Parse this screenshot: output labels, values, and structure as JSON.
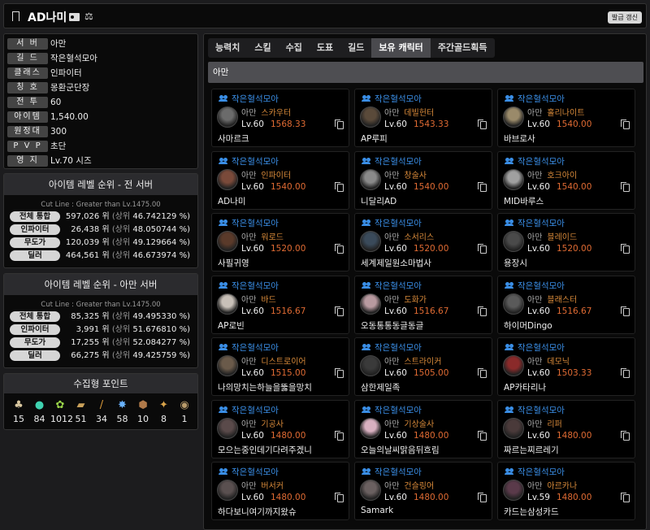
{
  "header": {
    "title": "AD나미",
    "refresh_label": "발급 갱신"
  },
  "info": [
    {
      "label": "서 버",
      "value": "아만"
    },
    {
      "label": "길 드",
      "value": "작은혈석모아"
    },
    {
      "label": "클래스",
      "value": "인파이터"
    },
    {
      "label": "칭 호",
      "value": "몽환군단장"
    },
    {
      "label": "전 투",
      "value": "60"
    },
    {
      "label": "아이템",
      "value": "1,540.00"
    },
    {
      "label": "원정대",
      "value": "300"
    },
    {
      "label": "P V P",
      "value": "초단"
    },
    {
      "label": "영 지",
      "value": "Lv.70 시즈"
    }
  ],
  "rank_all": {
    "title": "아이템 레벨 순위 - 전 서버",
    "cut": "Cut Line : Greater than Lv.1475.00",
    "rows": [
      {
        "label": "전체 통합",
        "rank": "597,026 위",
        "pct_label": "(상위",
        "pct": "46.742129 %)"
      },
      {
        "label": "인파이터",
        "rank": "26,438 위",
        "pct_label": "(상위",
        "pct": "48.050744 %)"
      },
      {
        "label": "무도가",
        "rank": "120,039 위",
        "pct_label": "(상위",
        "pct": "49.129664 %)"
      },
      {
        "label": "딜러",
        "rank": "464,561 위",
        "pct_label": "(상위",
        "pct": "46.673974 %)"
      }
    ]
  },
  "rank_server": {
    "title": "아이템 레벨 순위 - 아만 서버",
    "cut": "Cut Line : Greater than Lv.1475.00",
    "rows": [
      {
        "label": "전체 통합",
        "rank": "85,325 위",
        "pct_label": "(상위",
        "pct": "49.495330 %)"
      },
      {
        "label": "인파이터",
        "rank": "3,991 위",
        "pct_label": "(상위",
        "pct": "51.676810 %)"
      },
      {
        "label": "무도가",
        "rank": "17,255 위",
        "pct_label": "(상위",
        "pct": "52.084277 %)"
      },
      {
        "label": "딜러",
        "rank": "66,275 위",
        "pct_label": "(상위",
        "pct": "49.425759 %)"
      }
    ]
  },
  "collect": {
    "title": "수집형 포인트",
    "items": [
      {
        "icon": "mokoko-seed-icon",
        "glyph": "♣",
        "color": "#d9c7a0",
        "value": "15"
      },
      {
        "icon": "island-heart-icon",
        "glyph": "●",
        "color": "#3fd2b0",
        "value": "84"
      },
      {
        "icon": "giant-heart-icon",
        "glyph": "✿",
        "color": "#9bd64a",
        "value": "1012"
      },
      {
        "icon": "masterpiece-icon",
        "glyph": "▰",
        "color": "#c9a15a",
        "value": "51"
      },
      {
        "icon": "adventure-book-icon",
        "glyph": "/",
        "color": "#d99a3a",
        "value": "34"
      },
      {
        "icon": "sea-bounty-icon",
        "glyph": "✸",
        "color": "#6ab3ff",
        "value": "58"
      },
      {
        "icon": "ignea-token-icon",
        "glyph": "⬢",
        "color": "#b07a4a",
        "value": "10"
      },
      {
        "icon": "orpheus-star-icon",
        "glyph": "✦",
        "color": "#d8a34a",
        "value": "8"
      },
      {
        "icon": "world-tree-leaf-icon",
        "glyph": "◉",
        "color": "#b89a6a",
        "value": "1"
      }
    ]
  },
  "tabs": [
    {
      "label": "능력치",
      "active": false
    },
    {
      "label": "스킬",
      "active": false
    },
    {
      "label": "수집",
      "active": false
    },
    {
      "label": "도표",
      "active": false
    },
    {
      "label": "길드",
      "active": false
    },
    {
      "label": "보유 캐릭터",
      "active": true
    },
    {
      "label": "주간골드획득",
      "active": false
    }
  ],
  "server_bar": "아만",
  "characters": [
    {
      "guild": "작은혈석모아",
      "server": "아만",
      "class": "스카우터",
      "level": "Lv.60",
      "ilvl": "1568.33",
      "name": "사마르크",
      "avatar_color": "#6b6b6b"
    },
    {
      "guild": "작은혈석모아",
      "server": "아만",
      "class": "데빌헌터",
      "level": "Lv.60",
      "ilvl": "1543.33",
      "name": "AP루피",
      "avatar_color": "#5a4a3a"
    },
    {
      "guild": "작은혈석모아",
      "server": "아만",
      "class": "홀리나이트",
      "level": "Lv.60",
      "ilvl": "1540.00",
      "name": "바브로사",
      "avatar_color": "#9a8a6a"
    },
    {
      "guild": "작은혈석모아",
      "server": "아만",
      "class": "인파이터",
      "level": "Lv.60",
      "ilvl": "1540.00",
      "name": "AD나미",
      "avatar_color": "#7a4a3a"
    },
    {
      "guild": "작은혈석모아",
      "server": "아만",
      "class": "창술사",
      "level": "Lv.60",
      "ilvl": "1540.00",
      "name": "니달리AD",
      "avatar_color": "#8a8a8a"
    },
    {
      "guild": "작은혈석모아",
      "server": "아만",
      "class": "호크아이",
      "level": "Lv.60",
      "ilvl": "1540.00",
      "name": "MID바루스",
      "avatar_color": "#a0a0a0"
    },
    {
      "guild": "작은혈석모아",
      "server": "아만",
      "class": "워로드",
      "level": "Lv.60",
      "ilvl": "1520.00",
      "name": "사필귀영",
      "avatar_color": "#5a3a2a"
    },
    {
      "guild": "작은혈석모아",
      "server": "아만",
      "class": "소서리스",
      "level": "Lv.60",
      "ilvl": "1520.00",
      "name": "세계제일원소마법사",
      "avatar_color": "#3a4a5a"
    },
    {
      "guild": "작은혈석모아",
      "server": "아만",
      "class": "블레이드",
      "level": "Lv.60",
      "ilvl": "1520.00",
      "name": "용장시",
      "avatar_color": "#4a4a4a"
    },
    {
      "guild": "작은혈석모아",
      "server": "아만",
      "class": "바드",
      "level": "Lv.60",
      "ilvl": "1516.67",
      "name": "AP로빈",
      "avatar_color": "#c8c0b8"
    },
    {
      "guild": "작은혈석모아",
      "server": "아만",
      "class": "도화가",
      "level": "Lv.60",
      "ilvl": "1516.67",
      "name": "오동통통동글동글",
      "avatar_color": "#b89aa0"
    },
    {
      "guild": "작은혈석모아",
      "server": "아만",
      "class": "블래스터",
      "level": "Lv.60",
      "ilvl": "1516.67",
      "name": "하이머Dingo",
      "avatar_color": "#5a5a5a"
    },
    {
      "guild": "작은혈석모아",
      "server": "아만",
      "class": "디스트로이어",
      "level": "Lv.60",
      "ilvl": "1515.00",
      "name": "나의망치는하늘을뚫을망치",
      "avatar_color": "#6a5a4a"
    },
    {
      "guild": "작은혈석모아",
      "server": "아만",
      "class": "스트라이커",
      "level": "Lv.60",
      "ilvl": "1505.00",
      "name": "삼한제일족",
      "avatar_color": "#3a3a3a"
    },
    {
      "guild": "작은혈석모아",
      "server": "아만",
      "class": "데모닉",
      "level": "Lv.60",
      "ilvl": "1503.33",
      "name": "AP카타리나",
      "avatar_color": "#8a2a2a"
    },
    {
      "guild": "작은혈석모아",
      "server": "아만",
      "class": "기공사",
      "level": "Lv.60",
      "ilvl": "1480.00",
      "name": "모으는중인데기다려주겠니",
      "avatar_color": "#5a4a4a"
    },
    {
      "guild": "작은혈석모아",
      "server": "아만",
      "class": "기상술사",
      "level": "Lv.60",
      "ilvl": "1480.00",
      "name": "오늘의날씨맑음뒤흐림",
      "avatar_color": "#d8b0c0"
    },
    {
      "guild": "작은혈석모아",
      "server": "아만",
      "class": "리퍼",
      "level": "Lv.60",
      "ilvl": "1480.00",
      "name": "짜르는찌르레기",
      "avatar_color": "#4a3a3a"
    },
    {
      "guild": "작은혈석모아",
      "server": "아만",
      "class": "버서커",
      "level": "Lv.60",
      "ilvl": "1480.00",
      "name": "하다보니여기까지왔슈",
      "avatar_color": "#5a5050"
    },
    {
      "guild": "작은혈석모아",
      "server": "아만",
      "class": "건슬링어",
      "level": "Lv.60",
      "ilvl": "1480.00",
      "name": "Samark",
      "avatar_color": "#6a6060"
    },
    {
      "guild": "작은혈석모아",
      "server": "아만",
      "class": "아르카나",
      "level": "Lv.59",
      "ilvl": "1480.00",
      "name": "카드는삼성카드",
      "avatar_color": "#5a3a4a"
    }
  ]
}
